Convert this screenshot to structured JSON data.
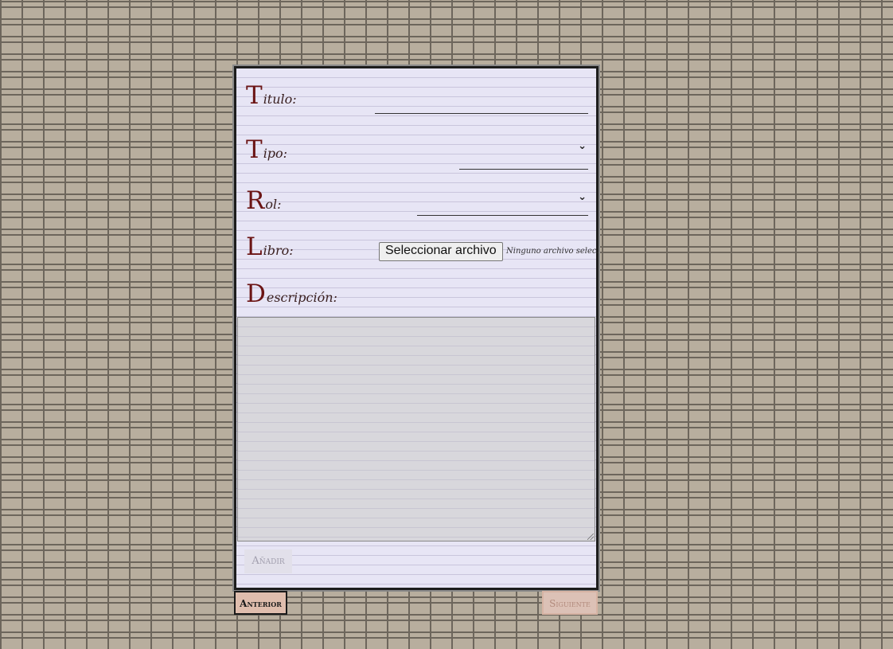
{
  "form": {
    "fields": {
      "titulo": {
        "cap": "T",
        "rest": "itulo:"
      },
      "tipo": {
        "cap": "T",
        "rest": "ipo:",
        "chevron": "⌄"
      },
      "rol": {
        "cap": "R",
        "rest": "ol:",
        "chevron": "⌄"
      },
      "libro": {
        "cap": "L",
        "rest": "ibro:",
        "button_label": "Seleccionar archivo",
        "status": "Ninguno archivo selec."
      },
      "descripcion": {
        "cap": "D",
        "rest": "escripción:"
      }
    },
    "add_button": "Añadir"
  },
  "nav": {
    "previous": "Anterior",
    "next": "Siguiente"
  },
  "colors": {
    "background": "#b8ae9e",
    "card": "#e7e5f5",
    "label_initial": "#6b1414",
    "prev_button": "#dfbdad",
    "next_button": "#dcc1b6"
  }
}
